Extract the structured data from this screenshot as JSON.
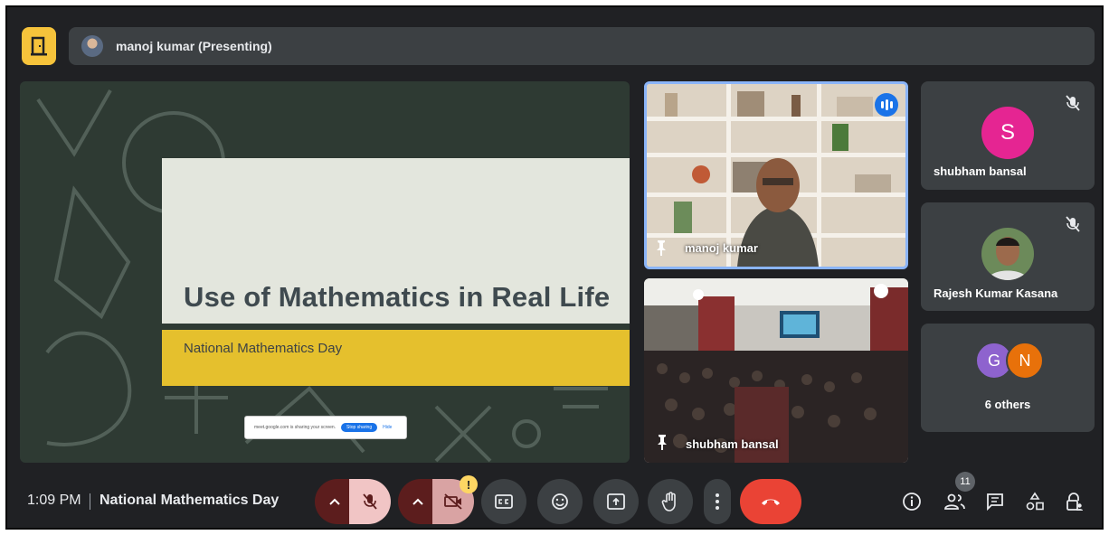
{
  "presenting_bar": {
    "presenter_text": "manoj kumar (Presenting)"
  },
  "slide": {
    "title": "Use of Mathematics in Real Life",
    "subtitle": "National Mathematics Day",
    "share_notice": {
      "message": "meet.google.com is sharing your screen.",
      "stop_label": "Stop sharing",
      "hide_label": "Hide"
    }
  },
  "tiles": {
    "presenter": {
      "name": "manoj kumar"
    },
    "classroom": {
      "name": "shubham bansal"
    },
    "side": [
      {
        "name": "shubham bansal",
        "initial": "S",
        "color": "#e52592",
        "muted": true
      },
      {
        "name": "Rajesh Kumar Kasana",
        "muted": true
      },
      {
        "label": "6 others",
        "initials": [
          "G",
          "N"
        ],
        "colors": [
          "#8e63ce",
          "#e8710a"
        ]
      }
    ]
  },
  "bottom_bar": {
    "time": "1:09 PM",
    "meeting_title": "National Mathematics Day",
    "participant_count": "11"
  },
  "colors": {
    "accent": "#8ab4f8",
    "end_call": "#ea4335",
    "logo": "#f6c33b",
    "background": "#202124"
  }
}
